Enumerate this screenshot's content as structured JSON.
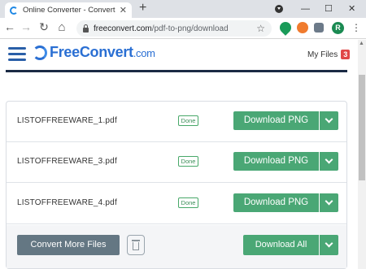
{
  "browser": {
    "tab_title": "Online Converter - Convert Imag",
    "tab_close": "✕",
    "new_tab": "+",
    "minimize": "—",
    "maximize": "☐",
    "close": "✕",
    "back": "←",
    "forward": "→",
    "reload": "↻",
    "home": "⌂",
    "url_domain": "freeconvert.com",
    "url_path": "/pdf-to-png/download",
    "star": "☆",
    "profile_initial": "R",
    "menu": "⋮"
  },
  "site": {
    "logo_name": "FreeConvert",
    "logo_tld": ".com",
    "my_files_label": "My Files",
    "my_files_count": "3"
  },
  "files": [
    {
      "name": "LISTOFFREEWARE_1.pdf",
      "status": "Done",
      "action": "Download PNG"
    },
    {
      "name": "LISTOFFREEWARE_3.pdf",
      "status": "Done",
      "action": "Download PNG"
    },
    {
      "name": "LISTOFFREEWARE_4.pdf",
      "status": "Done",
      "action": "Download PNG"
    }
  ],
  "footer": {
    "convert_more_label": "Convert More Files",
    "download_all_label": "Download All"
  },
  "colors": {
    "accent_green": "#4aa775",
    "brand_blue": "#2a6fd3",
    "badge_red": "#e04848"
  }
}
